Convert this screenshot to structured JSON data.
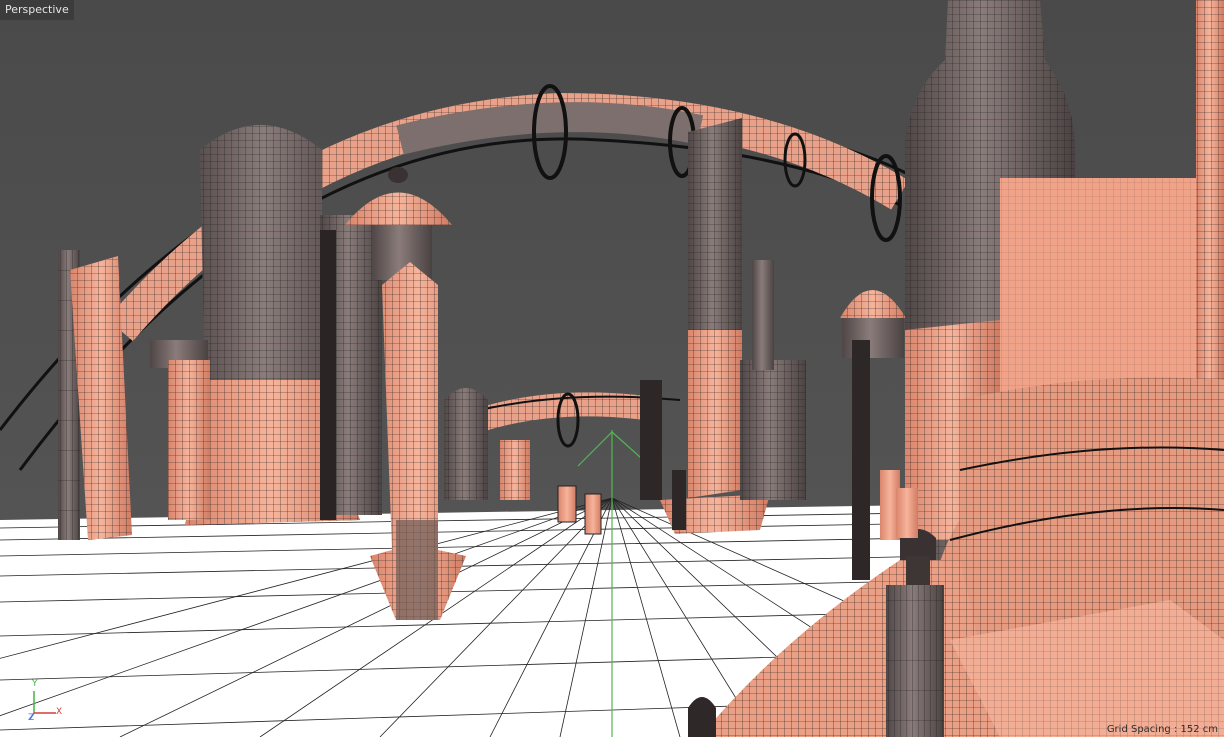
{
  "viewport": {
    "label": "Perspective",
    "grid_spacing_text": "Grid Spacing : 152 cm",
    "axes": {
      "x": "X",
      "y": "Y",
      "z": "Z"
    }
  },
  "colors": {
    "background": "#4a4a4a",
    "floor": "#ffffff",
    "grid_line": "#222222",
    "salmon": "#f4a88e",
    "metal": "#6e6464",
    "wire": "#1e1e1e",
    "green_axis": "#4fb84f",
    "x_axis": "#d43c3c",
    "y_axis": "#43b443",
    "z_axis": "#4a6fe0"
  }
}
